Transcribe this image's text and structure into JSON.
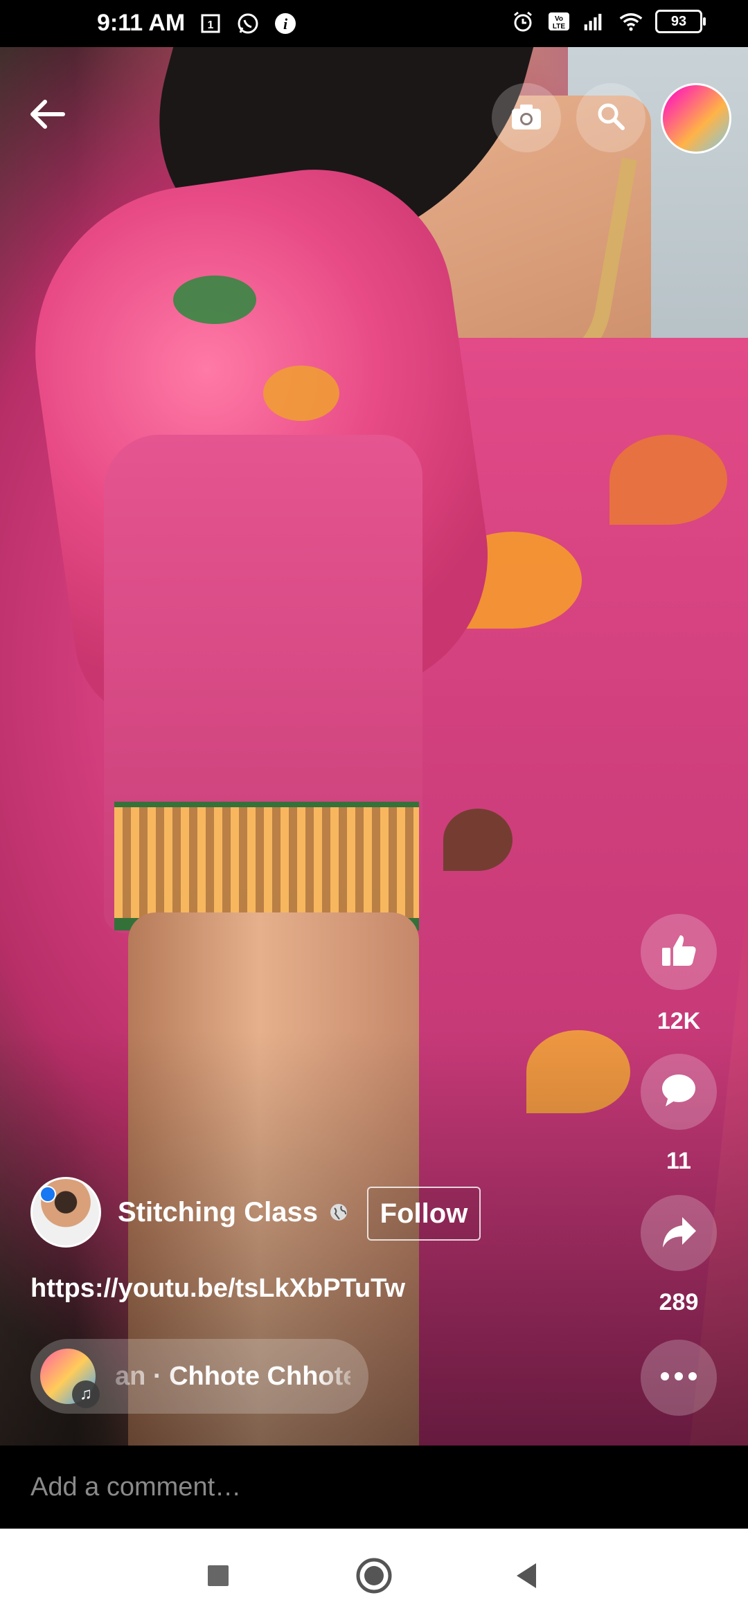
{
  "status_bar": {
    "time": "9:11 AM",
    "battery": "93",
    "icons": [
      "sim-card-icon",
      "whatsapp-icon",
      "info-icon",
      "alarm-icon",
      "volte-icon",
      "signal-icon",
      "wifi-icon",
      "battery-icon"
    ]
  },
  "top_bar": {
    "back_icon": "back-arrow-icon",
    "camera_icon": "camera-icon",
    "search_icon": "search-icon"
  },
  "actions": {
    "like_count": "12K",
    "comment_count": "11",
    "share_count": "289"
  },
  "post": {
    "author_name": "Stitching Class",
    "follow_label": "Follow",
    "caption": "https://youtu.be/tsLkXbPTuTw",
    "music_text": "an · Chhote Chhote"
  },
  "comment": {
    "placeholder": "Add a comment…"
  },
  "nav": {
    "icons": [
      "recents-square-icon",
      "home-circle-icon",
      "back-triangle-icon"
    ]
  }
}
